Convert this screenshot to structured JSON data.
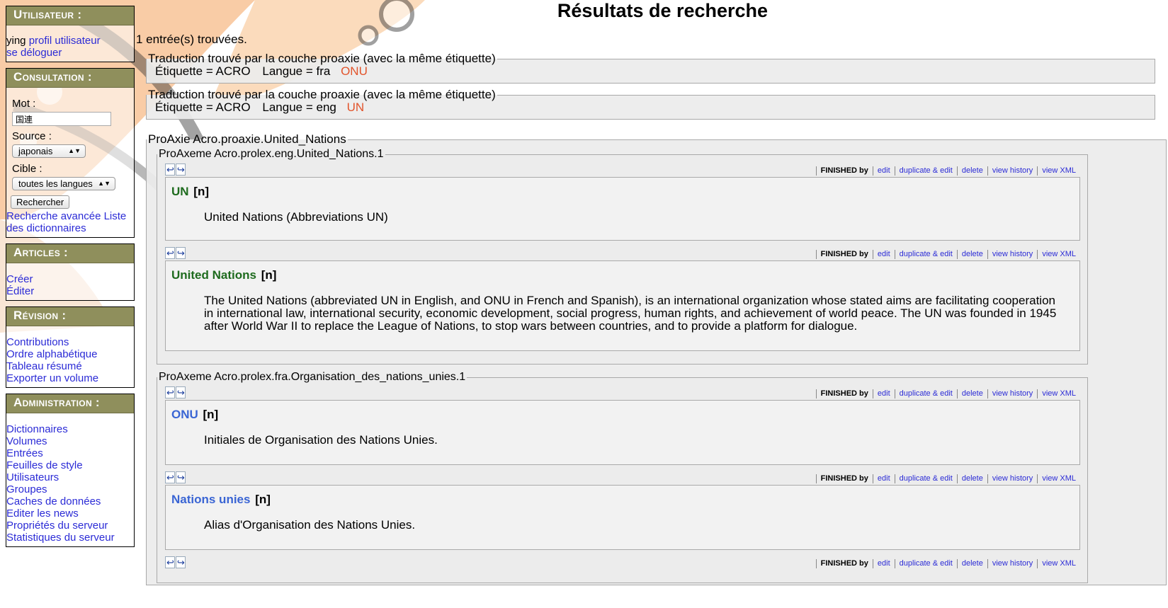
{
  "sidebar": {
    "user": {
      "title": "Utilisateur :",
      "username": "ying",
      "profile_link": "profil utilisateur",
      "logout_link": "se déloguer"
    },
    "consultation": {
      "title": "Consultation :",
      "word_label": "Mot :",
      "word_value": "国連",
      "source_label": "Source :",
      "source_value": "japonais",
      "target_label": "Cible :",
      "target_value": "toutes les langues",
      "search_button": "Rechercher",
      "advanced_link": "Recherche avancée",
      "dictionaries_link": "Liste des dictionnaires"
    },
    "articles": {
      "title": "Articles :",
      "items": [
        "Créer",
        "Éditer"
      ]
    },
    "revision": {
      "title": "Révision :",
      "items": [
        "Contributions",
        "Ordre alphabétique",
        "Tableau résumé",
        "Exporter un volume"
      ]
    },
    "administration": {
      "title": "Administration :",
      "items": [
        "Dictionnaires",
        "Volumes",
        "Entrées",
        "Feuilles de style",
        "Utilisateurs",
        "Groupes",
        "Caches de données",
        "Editer les news",
        "Propriétés du serveur",
        "Statistiques du serveur"
      ]
    }
  },
  "main": {
    "title": "Résultats de recherche",
    "count_text": "1 entrée(s) trouvées.",
    "translations": [
      {
        "legend": "Traduction trouvé par la couche proaxie (avec la même étiquette)",
        "label_text": "Étiquette = ACRO",
        "lang_text": "Langue = fra",
        "acronym": "ONU"
      },
      {
        "legend": "Traduction trouvé par la couche proaxie (avec la même étiquette)",
        "label_text": "Étiquette = ACRO",
        "lang_text": "Langue = eng",
        "acronym": "UN"
      }
    ],
    "proaxie_legend": "ProAxie Acro.proaxie.United_Nations",
    "toolbar": {
      "status": "FINISHED",
      "by": "by",
      "edit": "edit",
      "duplicate": "duplicate & edit",
      "delete": "delete",
      "history": "view history",
      "xml": "view XML",
      "undo_icon": "↩",
      "redo_icon": "↪"
    },
    "axemes": [
      {
        "legend": "ProAxeme Acro.prolex.eng.United_Nations.1",
        "entries": [
          {
            "headword": "UN",
            "pos": "[n]",
            "definition": "United Nations (Abbreviations UN)"
          },
          {
            "headword": "United Nations",
            "pos": "[n]",
            "definition": "The United Nations (abbreviated UN in English, and ONU in French and Spanish), is an international organization whose stated aims are facilitating cooperation in international law, international security, economic development, social progress, human rights, and achievement of world peace. The UN was founded in 1945 after World War II to replace the League of Nations, to stop wars between countries, and to provide a platform for dialogue."
          }
        ]
      },
      {
        "legend": "ProAxeme Acro.prolex.fra.Organisation_des_nations_unies.1",
        "entries": [
          {
            "headword": "ONU",
            "pos": "[n]",
            "definition": "Initiales de Organisation des Nations Unies."
          },
          {
            "headword": "Nations unies",
            "pos": "[n]",
            "definition": "Alias d'Organisation des Nations Unies."
          }
        ]
      }
    ]
  },
  "colors": {
    "sidebar_header": "#8f8f5c",
    "link": "#2b2bd6",
    "acronym": "#e2542b",
    "headword_eng": "#1e6b1e",
    "headword_fra": "#3a65d4"
  }
}
